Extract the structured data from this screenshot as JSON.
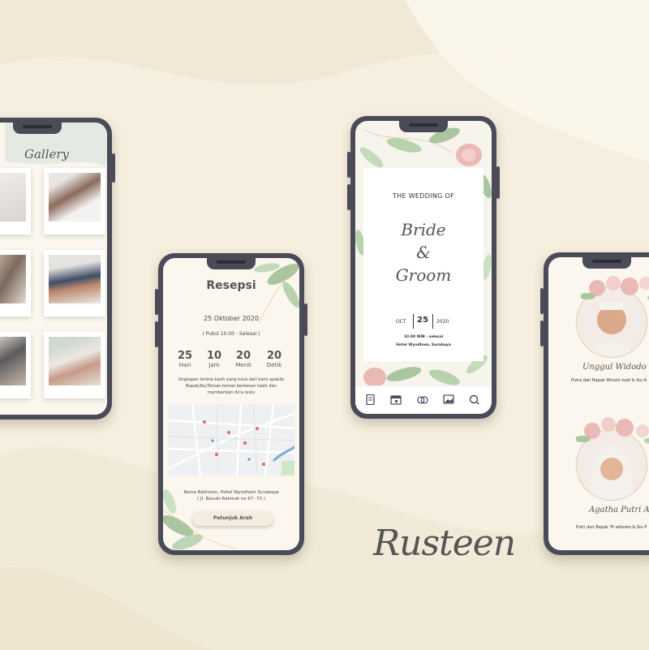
{
  "colors": {
    "background": "#f6efdf",
    "frame": "#4a4b57",
    "screen": "#fbf7ef",
    "leaf": "#a9c6a0",
    "flower": "#eab8b5"
  },
  "gallery": {
    "title": "Gallery"
  },
  "reception": {
    "title": "Resepsi",
    "date": "25 Oktober 2020",
    "time": "( Pukul 10.00 - Selesai )",
    "countdown": [
      {
        "value": "25",
        "unit": "Hari"
      },
      {
        "value": "10",
        "unit": "Jam"
      },
      {
        "value": "20",
        "unit": "Menit"
      },
      {
        "value": "20",
        "unit": "Detik"
      }
    ],
    "note_line1": "Ungkapan terima kasih yang tulus dari kami apabila",
    "note_line2": "Bapak/Ibu/Teman-teman berkenan hadir dan",
    "note_line3": "memberikan do'a restu",
    "venue_line1": "Roma Ballroom, Hotel Wyndham Surabaya",
    "venue_line2": "( Jl. Basuki Rahmat no 67 -73 )",
    "button": "Petunjuk Arah"
  },
  "cover": {
    "heading": "THE WEDDING OF",
    "bride": "Bride",
    "amp": "&",
    "groom": "Groom",
    "month": "OCT",
    "day": "25",
    "year": "2020",
    "time": "10.00 WIB - selesai",
    "venue": "Hotel Wyndham, Surabaya",
    "nav_icons": [
      "invitation-icon",
      "calendar-icon",
      "rings-icon",
      "gallery-icon",
      "chat-icon"
    ]
  },
  "couple": {
    "groom_name": "Unggul Widodo W",
    "groom_parents": "Putra dari Bapak Winoto hadi & Ibu A",
    "bride_name": "Agatha Putri A",
    "bride_parents": "Putri dari Bapak Tri wibowo & Ibu P"
  },
  "brand": {
    "name": "Rusteen"
  }
}
